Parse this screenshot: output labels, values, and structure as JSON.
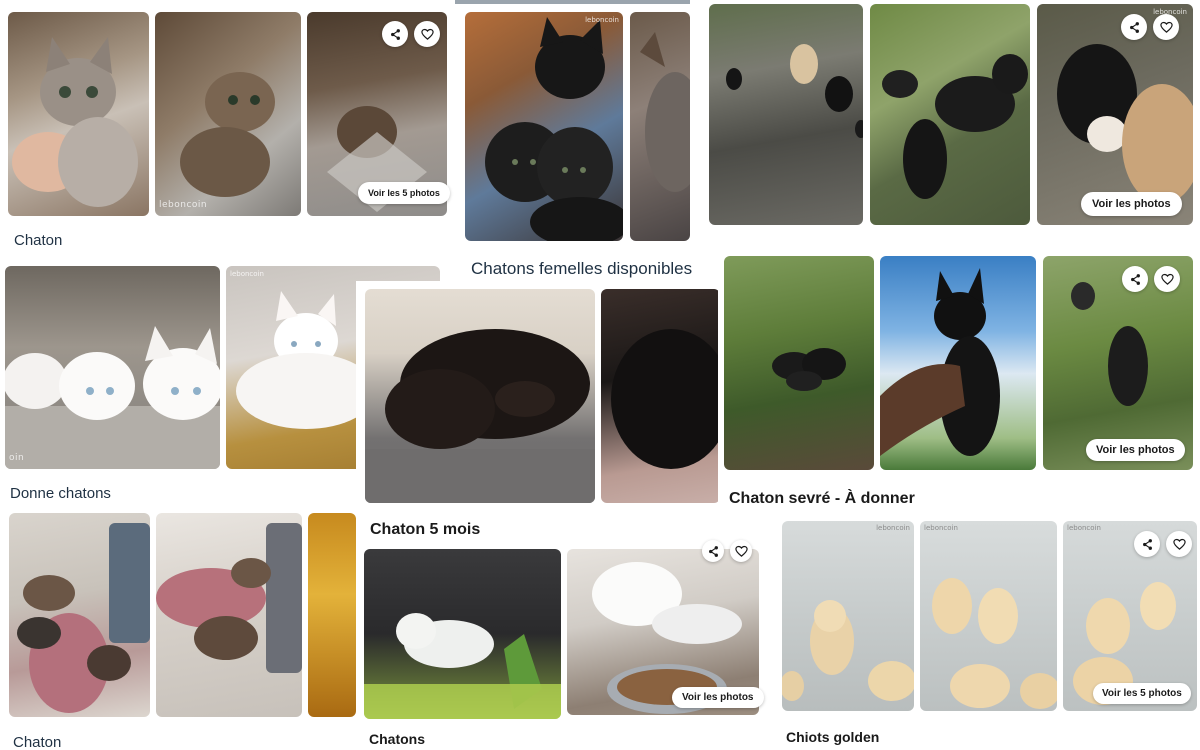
{
  "listings": [
    {
      "title": "Chaton",
      "photo_count_label": "Voir les 5 photos"
    },
    {
      "title": "Chatons femelles disponibles"
    },
    {
      "photo_count_label": "Voir les photos"
    },
    {
      "title": "Donne chatons",
      "photo_label": "oin"
    },
    {
      "title": "Chaton 5 mois"
    },
    {
      "title": "Chaton sevré - À donner",
      "photo_count_label": "Voir les photos"
    },
    {
      "title": "Chaton"
    },
    {
      "title": "Chatons",
      "photo_count_label": "Voir les photos"
    },
    {
      "title": "Chiots golden",
      "photo_count_label": "Voir les 5 photos"
    }
  ],
  "icons": {
    "share": "share-icon",
    "favorite": "heart-icon"
  },
  "watermark": "leboncoin",
  "colors": {
    "title": "#1f3143",
    "pill_bg": "#ffffff"
  }
}
